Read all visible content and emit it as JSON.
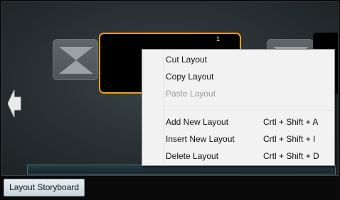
{
  "storyboard": {
    "selected_thumbnail_number": "1",
    "tab_label": "Layout Storyboard"
  },
  "context_menu": {
    "items": [
      {
        "label": "Cut Layout",
        "shortcut": "",
        "enabled": true
      },
      {
        "label": "Copy Layout",
        "shortcut": "",
        "enabled": true
      },
      {
        "label": "Paste Layout",
        "shortcut": "",
        "enabled": false
      },
      {
        "label": "Add New Layout",
        "shortcut": "Crtl + Shift + A",
        "enabled": true
      },
      {
        "label": "Insert New Layout",
        "shortcut": "Crtl + Shift + I",
        "enabled": true
      },
      {
        "label": "Delete Layout",
        "shortcut": "Crtl + Shift + D",
        "enabled": true
      }
    ]
  },
  "icons": {
    "placeholder": "hourglass-placeholder-icon",
    "nav_left": "arrow-left-icon"
  },
  "colors": {
    "selection_border": "#f0a020",
    "menu_background": "#f2f2f2",
    "disabled_text": "#9a9a9a"
  }
}
